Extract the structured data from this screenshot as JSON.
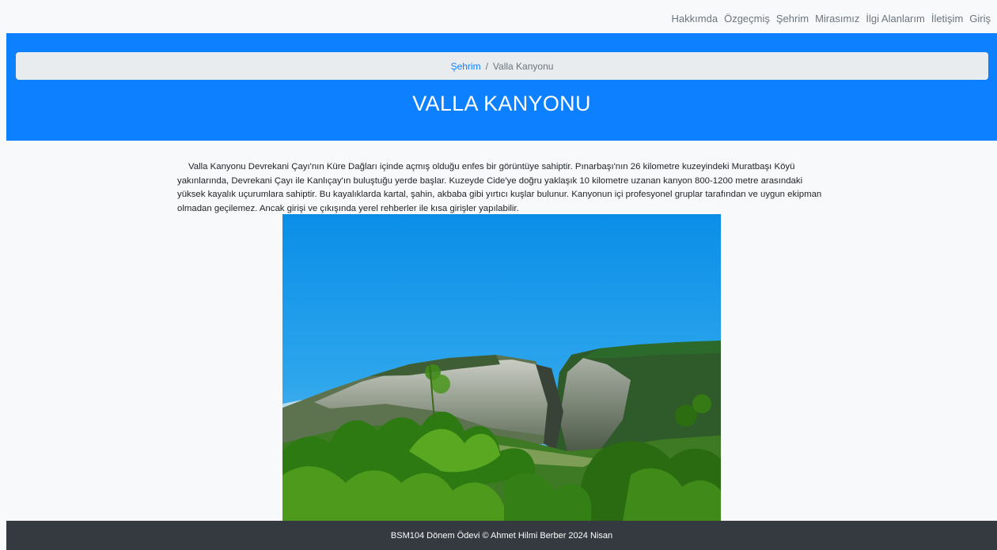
{
  "nav": {
    "items": [
      {
        "label": "Hakkımda"
      },
      {
        "label": "Özgeçmiş"
      },
      {
        "label": "Şehrim"
      },
      {
        "label": "Mirasımız"
      },
      {
        "label": "İlgi Alanlarım"
      },
      {
        "label": "İletişim"
      },
      {
        "label": "Giriş"
      }
    ]
  },
  "breadcrumb": {
    "parent": "Şehrim",
    "separator": "/",
    "current": "Valla Kanyonu"
  },
  "hero": {
    "title": "VALLA KANYONU"
  },
  "article": {
    "text": "Valla Kanyonu Devrekani Çayı'nın Küre Dağları içinde açmış olduğu enfes bir görüntüye sahiptir. Pınarbaşı'nın 26 kilometre kuzeyindeki Muratbaşı Köyü yakınlarında, Devrekani Çayı ile Kanlıçay'ın buluştuğu yerde başlar. Kuzeyde Cide'ye doğru yaklaşık 10 kilometre uzanan kanyon 800-1200 metre arasındaki yüksek kayalık uçurumlara sahiptir. Bu kayalıklarda kartal, şahin, akbaba gibi yırtıcı kuşlar bulunur. Kanyonun içi profesyonel gruplar tarafından ve uygun ekipman olmadan geçilemez. Ancak girişi ve çıkışında yerel rehberler ile kısa girişler yapılabilir."
  },
  "footer": {
    "text": "BSM104 Dönem Ödevi © Ahmet Hilmi Berber 2024 Nisan"
  },
  "colors": {
    "primary": "#0d80ff",
    "footer_bg": "#343a40",
    "breadcrumb_bg": "#e9ecef"
  }
}
